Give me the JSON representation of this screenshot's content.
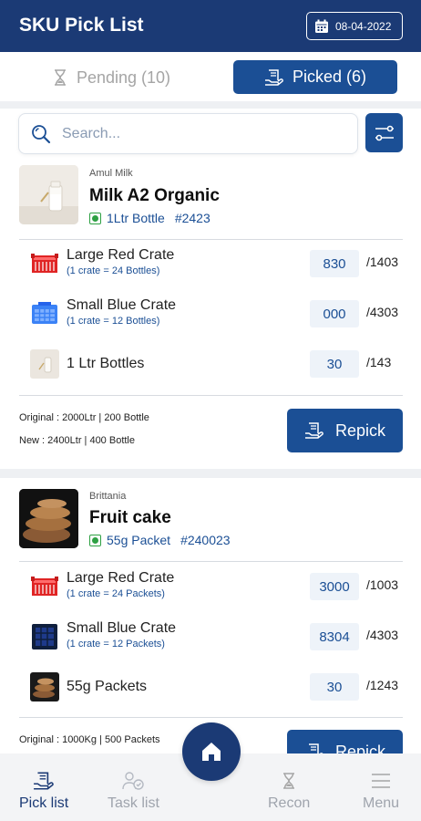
{
  "header": {
    "title": "SKU Pick List",
    "date": "08-04-2022"
  },
  "tabs": {
    "pending": "Pending (10)",
    "picked": "Picked (6)"
  },
  "search": {
    "placeholder": "Search..."
  },
  "products": [
    {
      "brand": "Amul Milk",
      "name": "Milk A2 Organic",
      "variant": "1Ltr Bottle",
      "code": "#2423",
      "rows": [
        {
          "name": "Large Red Crate",
          "sub": "(1 crate = 24 Bottles)",
          "qty": "830",
          "total": "/1403"
        },
        {
          "name": "Small Blue Crate",
          "sub": "(1 crate = 12 Bottles)",
          "qty": "000",
          "total": "/4303"
        },
        {
          "name": "1 Ltr Bottles",
          "sub": "",
          "qty": "30",
          "total": "/143"
        }
      ],
      "original": "Original : 2000Ltr | 200 Bottle",
      "new": "New : 2400Ltr | 400 Bottle",
      "action": "Repick"
    },
    {
      "brand": "Brittania",
      "name": "Fruit cake",
      "variant": "55g Packet",
      "code": "#240023",
      "rows": [
        {
          "name": "Large Red Crate",
          "sub": "(1 crate = 24 Packets)",
          "qty": "3000",
          "total": "/1003"
        },
        {
          "name": "Small Blue Crate",
          "sub": "(1 crate = 12 Packets)",
          "qty": "8304",
          "total": "/4303"
        },
        {
          "name": "55g Packets",
          "sub": "",
          "qty": "30",
          "total": "/1243"
        }
      ],
      "original": "Original : 1000Kg | 500 Packets",
      "action": "Repick"
    }
  ],
  "nav": {
    "items": [
      {
        "label": "Pick list",
        "icon": "bill-icon",
        "active": true
      },
      {
        "label": "Task list",
        "icon": "task-icon",
        "active": false
      },
      {
        "label": "Recon",
        "icon": "hourglass-icon",
        "active": false
      },
      {
        "label": "Menu",
        "icon": "menu-icon",
        "active": false
      }
    ],
    "home_icon": "home-icon"
  },
  "colors": {
    "primary": "#1b3a75",
    "accent": "#1b4f95",
    "veg": "#2ea043",
    "red_crate": "#e02424",
    "blue_crate": "#3b82f6"
  }
}
